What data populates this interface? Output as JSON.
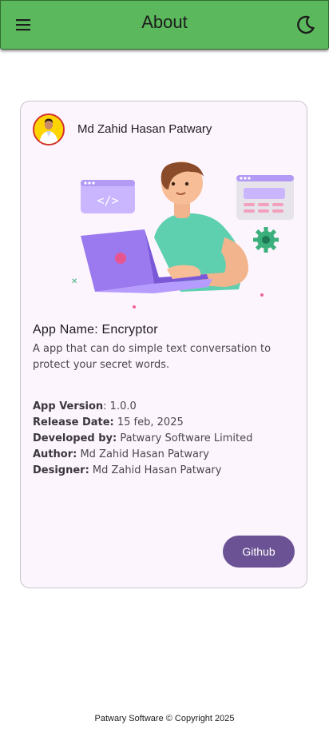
{
  "appbar": {
    "title": "About",
    "menu_icon": "menu-icon",
    "theme_icon": "dark-mode-moon-icon"
  },
  "card": {
    "author_name": "Md Zahid Hasan Patwary",
    "app_name": "App Name: Encryptor",
    "description": "A app that can do simple text conversation to protect your secret words.",
    "details": {
      "version_label": "App Version",
      "version_value": ": 1.0.0",
      "release_label": "Release Date:",
      "release_value": " 15 feb, 2025",
      "developer_label": "Developed by:",
      "developer_value": " Patwary Software Limited",
      "author_label": "Author:",
      "author_value": " Md Zahid Hasan Patwary",
      "designer_label": "Designer:",
      "designer_value": " Md Zahid Hasan Patwary"
    },
    "github_label": "Github"
  },
  "footer": {
    "text": "Patwary Software © Copyright 2025"
  },
  "colors": {
    "appbar": "#5cb85c",
    "card_bg": "#fdf5fd",
    "button": "#6a5294",
    "laptop": "#9b7af0"
  }
}
